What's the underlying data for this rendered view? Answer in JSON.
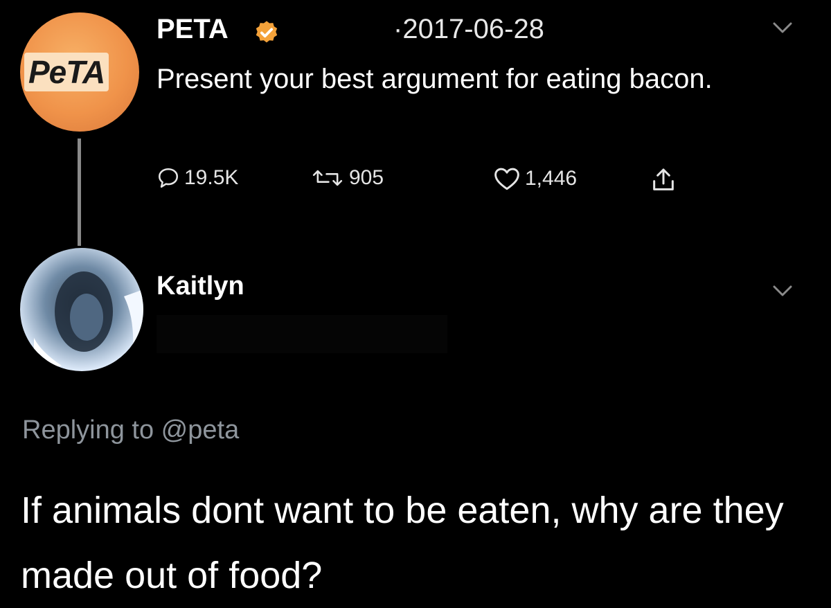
{
  "original_tweet": {
    "author": "PETA",
    "date": "·2017-06-28",
    "avatar_logo_text": "PeTA",
    "text": "Present your best argument for eating bacon.",
    "stats": {
      "replies": "19.5K",
      "retweets": "905",
      "likes": "1,446"
    }
  },
  "reply_tweet": {
    "author": "Kaitlyn",
    "replying_to": "Replying to @peta",
    "text": "If animals dont want to be eaten, why are they made out of food?"
  },
  "colors": {
    "background": "#000000",
    "verified_badge": "#f4a23a",
    "muted_text": "#8e959c"
  },
  "icons": [
    "verified-badge-icon",
    "chevron-down-icon",
    "reply-icon",
    "retweet-icon",
    "like-icon",
    "share-icon"
  ]
}
